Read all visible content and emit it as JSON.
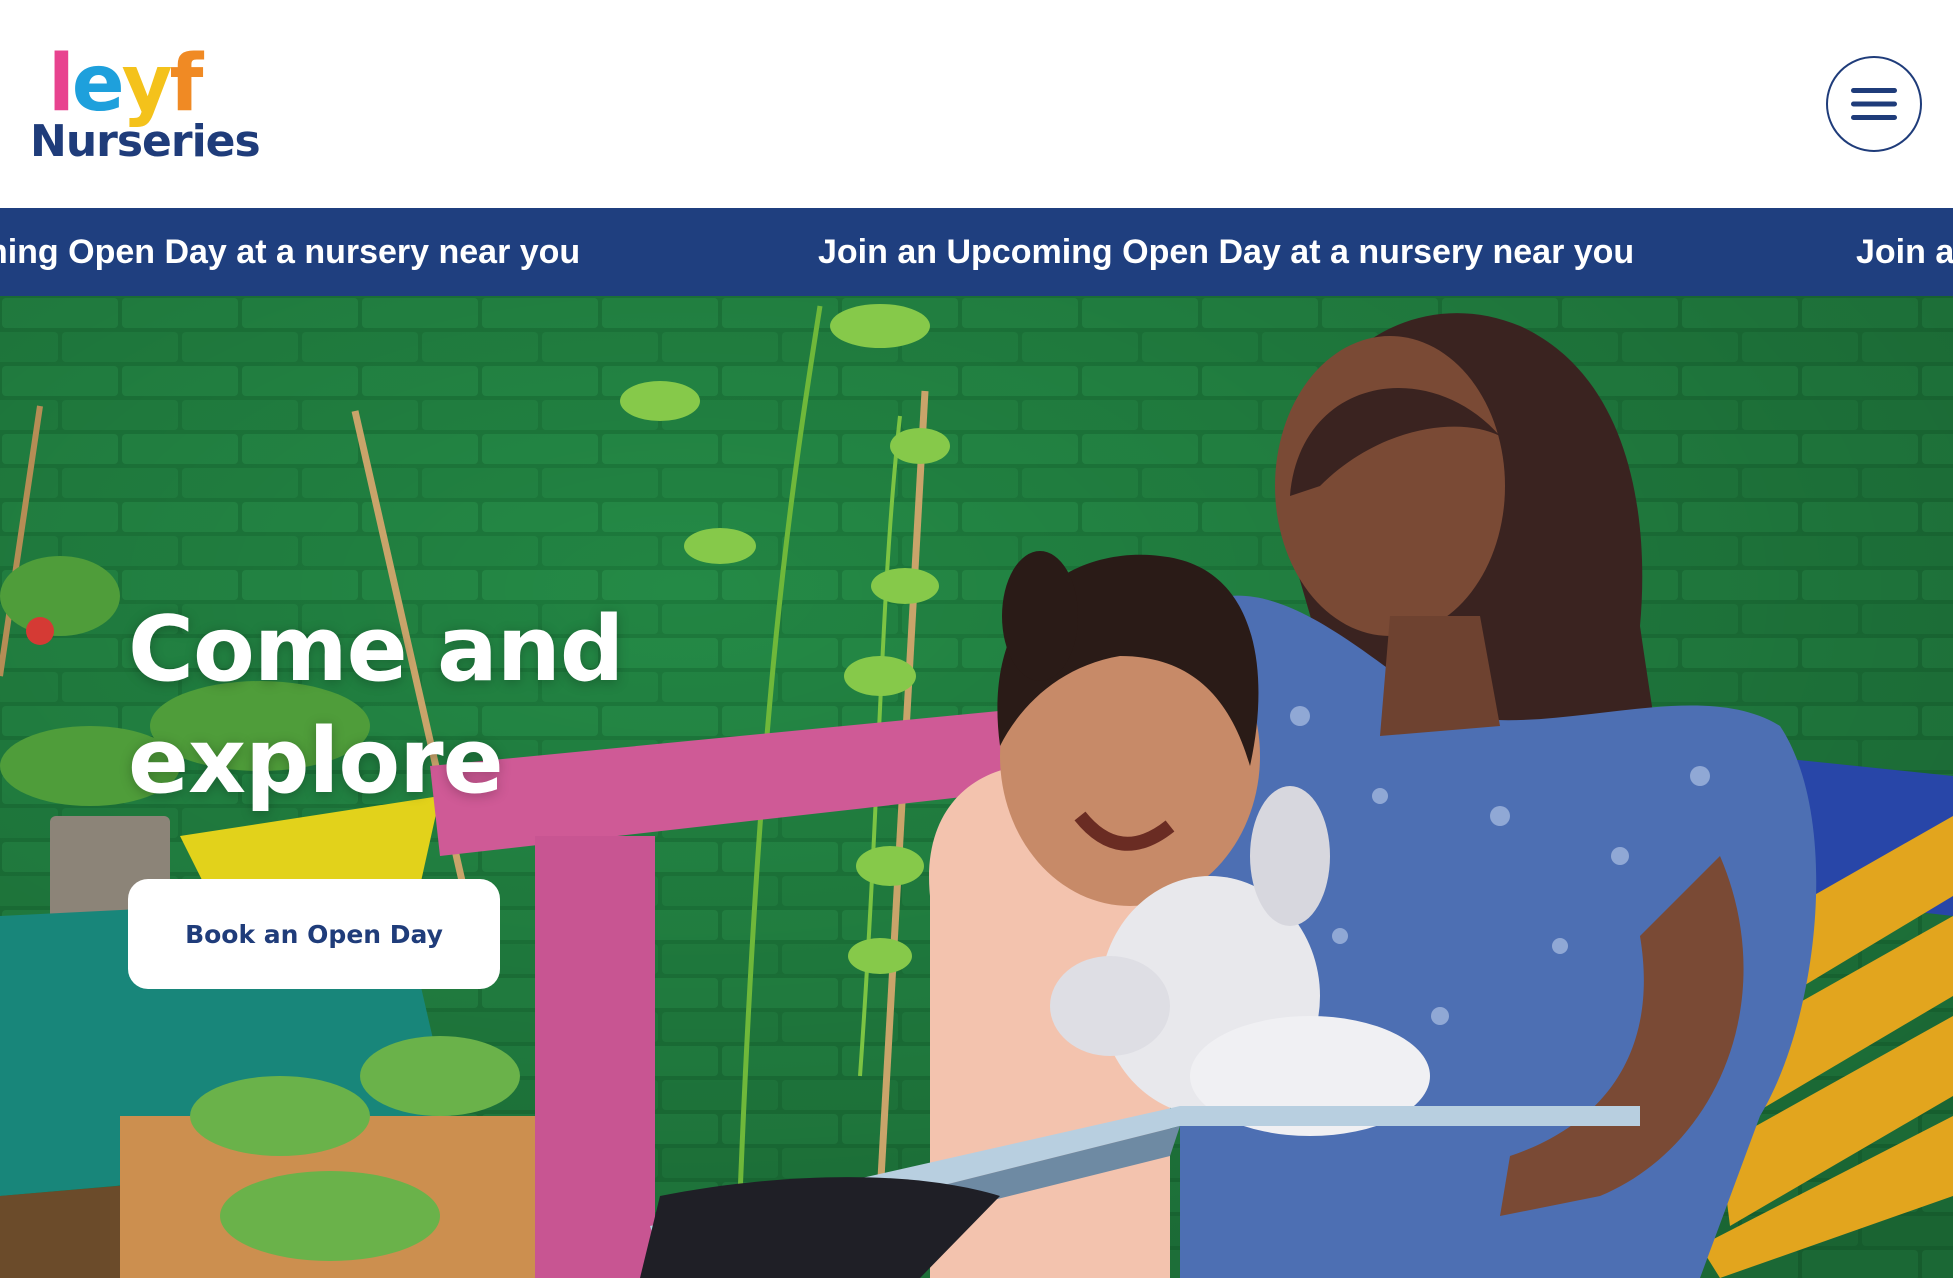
{
  "header": {
    "logo_letters": [
      "l",
      "e",
      "y",
      "f"
    ],
    "logo_colors": [
      "#e8438f",
      "#1ea0dc",
      "#f4c21b",
      "#f08a24"
    ],
    "logo_subtitle": "Nurseries",
    "menu_icon": "hamburger-icon"
  },
  "ticker": {
    "items": [
      "Join an Upcoming Open Day at a nursery near you",
      "Join an Upcoming Open Day at a nursery near you",
      "Join an Upcoming Open Day at a nursery near you"
    ]
  },
  "hero": {
    "title_line1": "Come and",
    "title_line2": "explore",
    "cta_label": "Book an Open Day"
  },
  "colors": {
    "brand_navy": "#1f3c7a",
    "ticker_bg": "#1f3f7f",
    "wall_green": "#1e7a3f"
  }
}
